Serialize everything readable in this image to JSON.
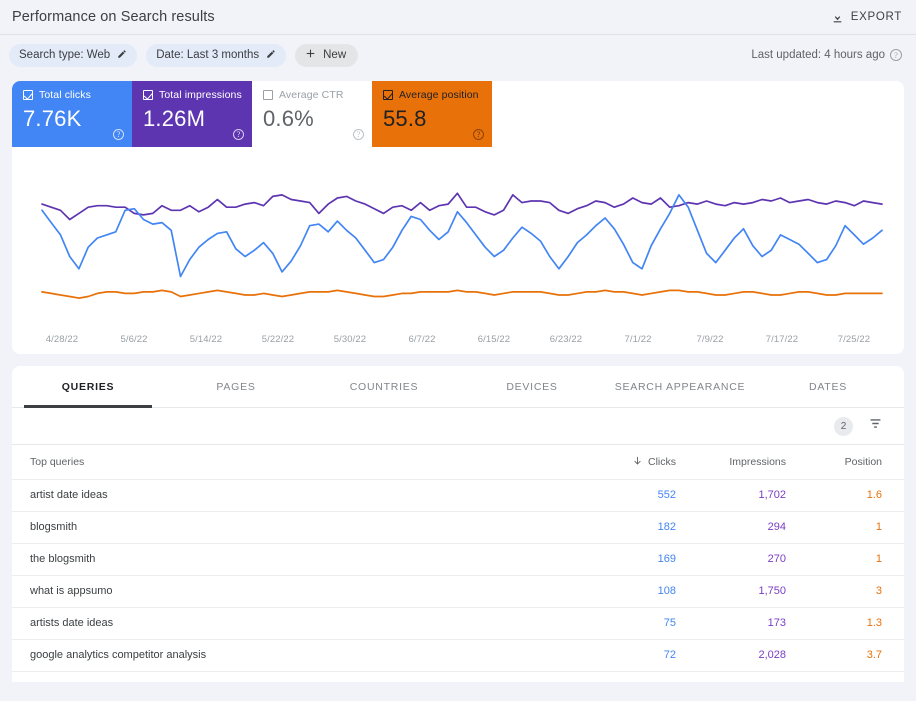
{
  "header": {
    "title": "Performance on Search results",
    "export_label": "EXPORT",
    "export_icon": "download-icon"
  },
  "filter_bar": {
    "chips": [
      {
        "label": "Search type: Web",
        "icon": "pencil-icon",
        "style": "blue"
      },
      {
        "label": "Date: Last 3 months",
        "icon": "pencil-icon",
        "style": "blue"
      },
      {
        "label": "New",
        "icon": "plus-icon",
        "style": "gray"
      }
    ],
    "last_updated": "Last updated: 4 hours ago",
    "help_icon": "help-circle-icon"
  },
  "metrics": [
    {
      "label": "Total clicks",
      "value": "7.76K",
      "checked": true,
      "color": "#4285f4",
      "text": "light"
    },
    {
      "label": "Total impressions",
      "value": "1.26M",
      "checked": true,
      "color": "#5e35b1",
      "text": "light"
    },
    {
      "label": "Average CTR",
      "value": "0.6%",
      "checked": false,
      "color": "#ffffff",
      "text": "off"
    },
    {
      "label": "Average position",
      "value": "55.8",
      "checked": true,
      "color": "#e8710a",
      "text": "dark"
    }
  ],
  "chart_data": {
    "type": "line",
    "title": "Performance on Search results",
    "xlabel": "",
    "ylabel": "",
    "grid": false,
    "legend_position": "top-cards",
    "x_tick_labels": [
      "4/28/22",
      "5/6/22",
      "5/14/22",
      "5/22/22",
      "5/30/22",
      "6/7/22",
      "6/15/22",
      "6/23/22",
      "7/1/22",
      "7/9/22",
      "7/17/22",
      "7/25/22"
    ],
    "x_range": [
      "4/28/22",
      "7/28/22"
    ],
    "series": [
      {
        "name": "Total impressions",
        "color": "#5e35b1",
        "values": [
          72,
          70,
          68,
          62,
          66,
          70,
          71,
          71,
          70,
          70,
          66,
          65,
          66,
          71,
          68,
          68,
          71,
          67,
          70,
          75,
          70,
          70,
          72,
          73,
          71,
          77,
          78,
          75,
          74,
          73,
          66,
          72,
          76,
          77,
          74,
          72,
          69,
          66,
          70,
          71,
          68,
          73,
          68,
          71,
          72,
          79,
          70,
          70,
          67,
          65,
          68,
          78,
          73,
          74,
          74,
          73,
          68,
          66,
          69,
          71,
          74,
          73,
          70,
          72,
          76,
          73,
          72,
          76,
          70,
          71,
          73,
          72,
          74,
          72,
          71,
          73,
          72,
          73,
          75,
          74,
          76,
          73,
          74,
          75,
          73,
          72,
          74,
          73,
          71,
          74,
          73,
          72
        ]
      },
      {
        "name": "Total clicks",
        "color": "#4285f4",
        "values": [
          68,
          60,
          52,
          38,
          30,
          44,
          50,
          52,
          54,
          68,
          69,
          62,
          59,
          60,
          55,
          25,
          36,
          44,
          49,
          53,
          54,
          43,
          38,
          42,
          47,
          40,
          28,
          35,
          45,
          58,
          59,
          54,
          61,
          55,
          50,
          42,
          34,
          36,
          44,
          55,
          64,
          62,
          55,
          49,
          54,
          67,
          60,
          52,
          44,
          38,
          42,
          50,
          57,
          53,
          48,
          38,
          30,
          38,
          47,
          52,
          58,
          63,
          56,
          46,
          34,
          30,
          45,
          56,
          66,
          78,
          70,
          55,
          40,
          34,
          42,
          50,
          56,
          45,
          38,
          42,
          52,
          49,
          46,
          40,
          34,
          36,
          45,
          58,
          52,
          46,
          50,
          55
        ]
      },
      {
        "name": "Average position",
        "color": "#e8710a",
        "values": [
          15,
          14,
          13,
          12,
          11,
          12,
          14,
          15,
          15,
          14,
          14,
          15,
          15,
          16,
          15,
          12,
          13,
          14,
          15,
          16,
          15,
          14,
          13,
          13,
          14,
          13,
          12,
          13,
          14,
          15,
          15,
          15,
          16,
          15,
          14,
          13,
          12,
          12,
          13,
          14,
          14,
          15,
          15,
          15,
          15,
          16,
          15,
          15,
          14,
          13,
          14,
          15,
          15,
          15,
          15,
          14,
          13,
          13,
          14,
          15,
          15,
          16,
          15,
          15,
          14,
          13,
          14,
          15,
          16,
          16,
          15,
          15,
          14,
          13,
          13,
          14,
          15,
          15,
          14,
          13,
          13,
          14,
          15,
          15,
          14,
          13,
          13,
          14,
          14,
          14,
          14,
          14
        ]
      }
    ]
  },
  "table": {
    "tabs": [
      {
        "label": "QUERIES",
        "active": true
      },
      {
        "label": "PAGES",
        "active": false
      },
      {
        "label": "COUNTRIES",
        "active": false
      },
      {
        "label": "DEVICES",
        "active": false
      },
      {
        "label": "SEARCH APPEARANCE",
        "active": false
      },
      {
        "label": "DATES",
        "active": false
      }
    ],
    "filter_badge_count": "2",
    "filter_icon": "filter-list-icon",
    "columns": {
      "query": "Top queries",
      "clicks": "Clicks",
      "impressions": "Impressions",
      "position": "Position"
    },
    "sort": {
      "column": "clicks",
      "direction": "descending",
      "icon": "arrow-down-icon"
    },
    "rows": [
      {
        "query": "artist date ideas",
        "clicks": "552",
        "impressions": "1,702",
        "position": "1.6"
      },
      {
        "query": "blogsmith",
        "clicks": "182",
        "impressions": "294",
        "position": "1"
      },
      {
        "query": "the blogsmith",
        "clicks": "169",
        "impressions": "270",
        "position": "1"
      },
      {
        "query": "what is appsumo",
        "clicks": "108",
        "impressions": "1,750",
        "position": "3"
      },
      {
        "query": "artists date ideas",
        "clicks": "75",
        "impressions": "173",
        "position": "1.3"
      },
      {
        "query": "google analytics competitor analysis",
        "clicks": "72",
        "impressions": "2,028",
        "position": "3.7"
      }
    ]
  }
}
